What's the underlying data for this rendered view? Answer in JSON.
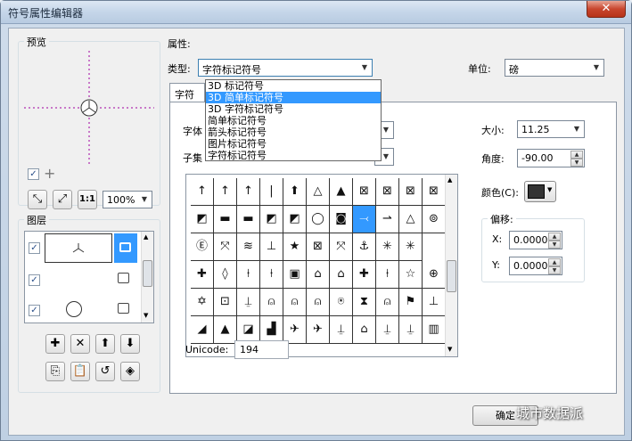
{
  "window": {
    "title": "符号属性编辑器",
    "close_label": "✕"
  },
  "preview": {
    "label": "预览",
    "zoom": "100%"
  },
  "layers": {
    "label": "图层"
  },
  "properties": {
    "label": "属性:",
    "type_label": "类型:",
    "type_value": "字符标记符号",
    "unit_label": "单位:",
    "unit_value": "磅",
    "type_options": [
      "3D 标记符号",
      "3D 简单标记符号",
      "3D 字符标记符号",
      "简单标记符号",
      "箭头标记符号",
      "图片标记符号",
      "字符标记符号"
    ],
    "tab_label": "字符",
    "font_label": "字体",
    "subset_label": "子集",
    "size_label": "大小:",
    "size_value": "11.25",
    "angle_label": "角度:",
    "angle_value": "-90.00",
    "color_label": "颜色(C):",
    "offset_label": "偏移:",
    "x_label": "X:",
    "x_value": "0.0000",
    "y_label": "Y:",
    "y_value": "0.0000",
    "unicode_label": "Unicode:",
    "unicode_value": "194"
  },
  "glyphs": [
    [
      "↑",
      "↑",
      "↑",
      "|",
      "⬆",
      "△",
      "▲",
      "⊠",
      "⊠",
      "⊠",
      "⊠"
    ],
    [
      "◩",
      "▬",
      "▬",
      "◩",
      "◩",
      "◯",
      "◙",
      "⤙",
      "⇀",
      "△",
      "⊚"
    ],
    [
      "Ⓔ",
      "⤧",
      "≋",
      "⊥",
      "★",
      "⊠",
      "⤧",
      "⚓",
      "✳",
      "✳"
    ],
    [
      "✚",
      "◊",
      "⍿",
      "⍿",
      "▣",
      "⌂",
      "⌂",
      "✚",
      "⍿",
      "☆",
      "⊕"
    ],
    [
      "✡",
      "⊡",
      "⍊",
      "⍝",
      "⍝",
      "⍝",
      "⍟",
      "⧗",
      "⍝",
      "⚑",
      "⊥"
    ],
    [
      "◢",
      "▲",
      "◪",
      "▟",
      "✈",
      "✈",
      "⍊",
      "⌂",
      "⍊",
      "⍊",
      "▥"
    ]
  ],
  "buttons": {
    "ok": "确定"
  },
  "colors": {
    "selection": "#3399ff",
    "close": "#c8462e"
  },
  "watermark": "城市数据派"
}
